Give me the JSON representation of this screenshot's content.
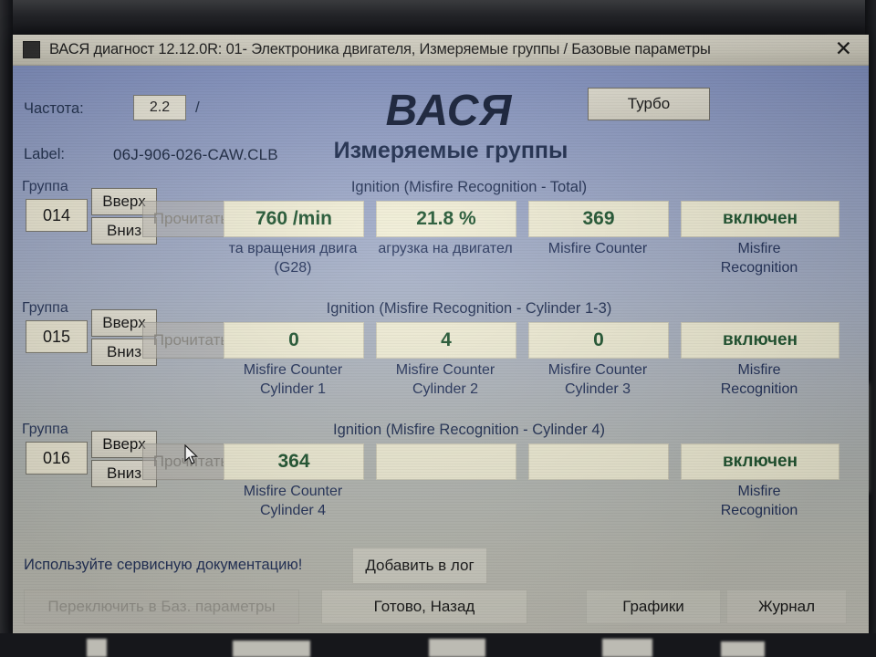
{
  "window": {
    "title": "ВАСЯ диагност 12.12.0R: 01- Электроника двигателя,  Измеряемые группы / Базовые параметры",
    "close_label": "✕",
    "app_icon": "app-square-icon"
  },
  "header": {
    "frequency_label": "Частота:",
    "frequency_value": "2.2",
    "separator": "/",
    "label_label": "Label:",
    "label_value": "06J-906-026-CAW.CLB",
    "logo": "ВАСЯ",
    "subtitle": "Измеряемые группы",
    "turbo_button": "Турбо"
  },
  "groups": [
    {
      "caption": "Группа",
      "number": "014",
      "up_label": "Вверх",
      "down_label": "Вниз",
      "read_label": "Прочитать",
      "block_title": "Ignition (Misfire Recognition - Total)",
      "fields": [
        {
          "value": "760 /min",
          "caption_line1": "та вращения двига",
          "caption_line2": "(G28)"
        },
        {
          "value": "21.8 %",
          "caption_line1": "агрузка на двигател",
          "caption_line2": ""
        },
        {
          "value": "369",
          "caption_line1": "Misfire Counter",
          "caption_line2": ""
        },
        {
          "value": "включен",
          "caption_line1": "Misfire",
          "caption_line2": "Recognition"
        }
      ]
    },
    {
      "caption": "Группа",
      "number": "015",
      "up_label": "Вверх",
      "down_label": "Вниз",
      "read_label": "Прочитать",
      "block_title": "Ignition (Misfire Recognition - Cylinder 1-3)",
      "fields": [
        {
          "value": "0",
          "caption_line1": "Misfire Counter",
          "caption_line2": "Cylinder 1"
        },
        {
          "value": "4",
          "caption_line1": "Misfire Counter",
          "caption_line2": "Cylinder 2"
        },
        {
          "value": "0",
          "caption_line1": "Misfire Counter",
          "caption_line2": "Cylinder 3"
        },
        {
          "value": "включен",
          "caption_line1": "Misfire",
          "caption_line2": "Recognition"
        }
      ]
    },
    {
      "caption": "Группа",
      "number": "016",
      "up_label": "Вверх",
      "down_label": "Вниз",
      "read_label": "Прочитать",
      "block_title": "Ignition (Misfire Recognition - Cylinder 4)",
      "fields": [
        {
          "value": "364",
          "caption_line1": "Misfire Counter",
          "caption_line2": "Cylinder 4"
        },
        {
          "value": "",
          "caption_line1": "",
          "caption_line2": ""
        },
        {
          "value": "",
          "caption_line1": "",
          "caption_line2": ""
        },
        {
          "value": "включен",
          "caption_line1": "Misfire",
          "caption_line2": "Recognition"
        }
      ]
    }
  ],
  "footer": {
    "hint": "Используйте сервисную документацию!",
    "add_to_log": "Добавить в лог",
    "switch_to_basic": "Переключить в Баз. параметры",
    "done_back": "Готово, Назад",
    "charts": "Графики",
    "journal": "Журнал"
  },
  "colors": {
    "field_bg": "#f1eed6",
    "field_text": "#1f5530",
    "caption_text": "#23325a",
    "titlebar_bg": "#d5d2c4",
    "window_top": "#7b8cc0",
    "window_bottom": "#c3c2b8"
  }
}
